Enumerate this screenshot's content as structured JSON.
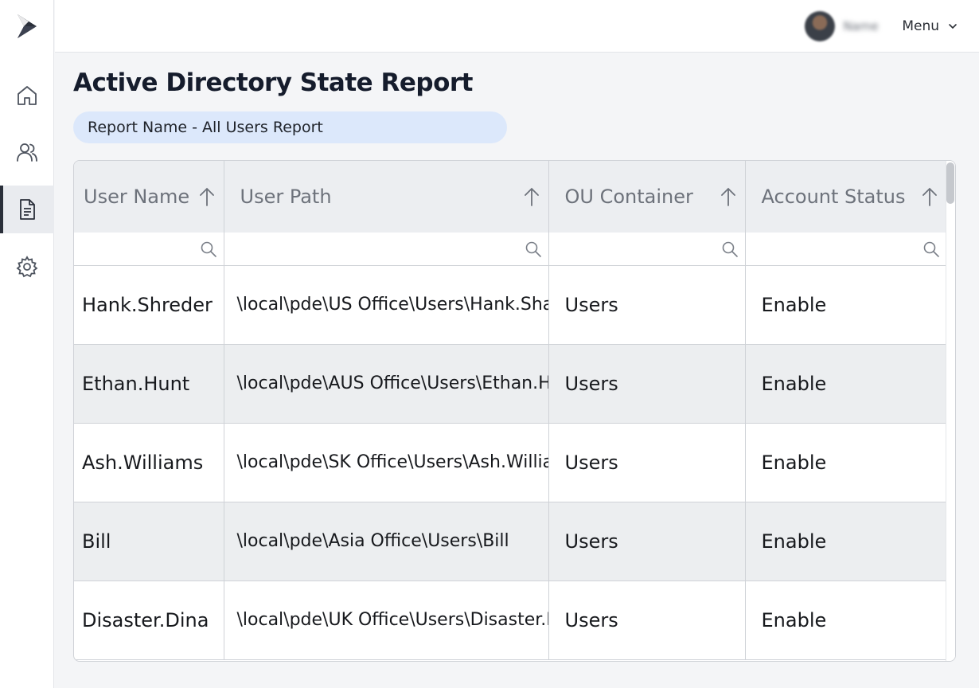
{
  "sidebar": {
    "logo": "brand-logo",
    "items": [
      {
        "icon": "home-icon"
      },
      {
        "icon": "users-icon"
      },
      {
        "icon": "document-icon",
        "active": true
      },
      {
        "icon": "gear-icon"
      }
    ]
  },
  "header": {
    "user_name": "Name",
    "menu_label": "Menu"
  },
  "page": {
    "title": "Active Directory State Report",
    "report_name": "Report Name - All Users Report"
  },
  "table": {
    "columns": [
      "User Name",
      "User Path",
      "OU Container",
      "Account Status"
    ],
    "rows": [
      [
        "Hank.Shreder",
        "\\local\\pde\\US Office\\Users\\Hank.Shader",
        "Users",
        "Enable"
      ],
      [
        "Ethan.Hunt",
        "\\local\\pde\\AUS Office\\Users\\Ethan.Hunt",
        "Users",
        "Enable"
      ],
      [
        "Ash.Williams",
        "\\local\\pde\\SK Office\\Users\\Ash.Williams",
        "Users",
        "Enable"
      ],
      [
        "Bill",
        "\\local\\pde\\Asia Office\\Users\\Bill",
        "Users",
        "Enable"
      ],
      [
        "Disaster.Dina",
        "\\local\\pde\\UK Office\\Users\\Disaster.Dina",
        "Users",
        "Enable"
      ]
    ]
  },
  "colors": {
    "accent_pill": "#dce8fb",
    "title": "#151c2c",
    "header_bg": "#eceef1"
  }
}
